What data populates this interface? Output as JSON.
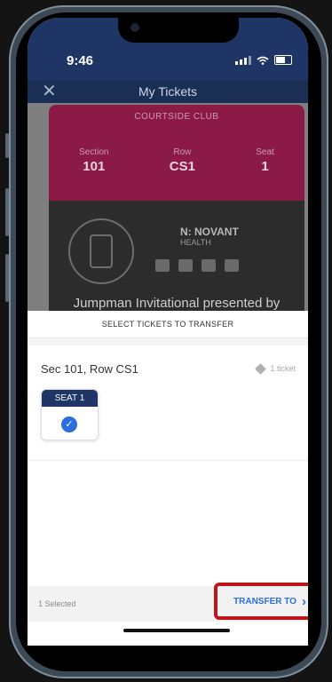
{
  "status_bar": {
    "time": "9:46",
    "icons": [
      "signal-icon",
      "wifi-icon",
      "battery-icon"
    ]
  },
  "header": {
    "title": "My Tickets",
    "close_icon": "close-icon"
  },
  "ticket": {
    "name": "COURTSIDE CLUB",
    "fields": [
      {
        "label": "Section",
        "value": "101"
      },
      {
        "label": "Row",
        "value": "CS1"
      },
      {
        "label": "Seat",
        "value": "1"
      }
    ],
    "sponsor_brand": "N: NOVANT",
    "sponsor_sub": "HEALTH",
    "event_title": "Jumpman Invitational presented by"
  },
  "transfer_sheet": {
    "title": "SELECT TICKETS TO TRANSFER",
    "group_label": "Sec 101, Row CS1",
    "ticket_count": "1 ticket",
    "seats": [
      {
        "label": "SEAT 1",
        "selected": true
      }
    ],
    "footer": {
      "selected_text": "1 Selected",
      "action_label": "TRANSFER TO"
    }
  },
  "colors": {
    "navy": "#1f3566",
    "ticket_magenta": "#8b1a46",
    "accent_blue": "#2a6fdb",
    "highlight_red": "#c0151b"
  }
}
